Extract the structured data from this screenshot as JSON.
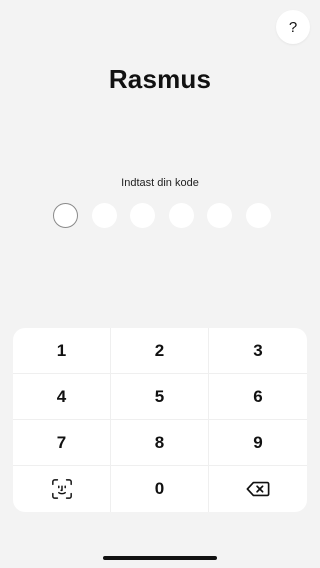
{
  "help": {
    "label": "?"
  },
  "user": {
    "name": "Rasmus"
  },
  "prompt": {
    "label": "Indtast din kode"
  },
  "pin": {
    "length": 6,
    "entered": 0
  },
  "keypad": {
    "keys": [
      "1",
      "2",
      "3",
      "4",
      "5",
      "6",
      "7",
      "8",
      "9"
    ],
    "zero": "0",
    "left_key_icon": "face-id-icon",
    "right_key_icon": "backspace-icon"
  }
}
